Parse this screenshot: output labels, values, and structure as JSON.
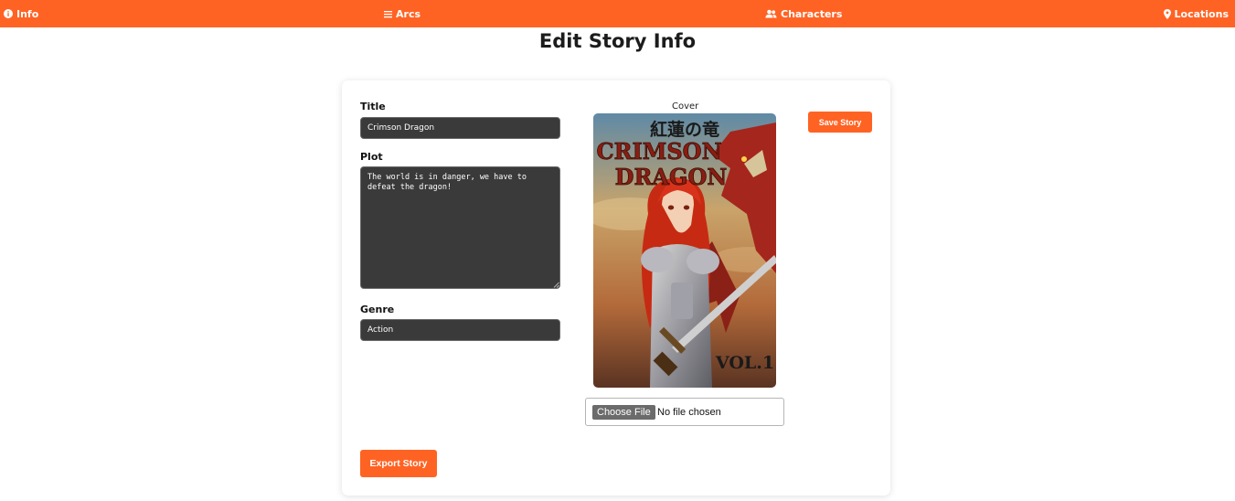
{
  "nav": {
    "info_label": "Info",
    "arcs_label": "Arcs",
    "characters_label": "Characters",
    "locations_label": "Locations"
  },
  "page": {
    "title": "Edit Story Info"
  },
  "form": {
    "title_label": "Title",
    "title_value": "Crimson Dragon",
    "plot_label": "Plot",
    "plot_value": "The world is in danger, we have to defeat the dragon!",
    "genre_label": "Genre",
    "genre_value": "Action"
  },
  "cover": {
    "label": "Cover",
    "image_title_jp": "紅蓮の竜",
    "image_title_line1": "CRIMSON",
    "image_title_line2": "DRAGON",
    "image_volume": "VOL.1",
    "file_button_label": "Choose File",
    "file_status": "No file chosen"
  },
  "actions": {
    "save_label": "Save Story",
    "export_label": "Export Story"
  },
  "colors": {
    "accent": "#ff6324",
    "input_bg": "#3a3a3a"
  },
  "icons": {
    "info": "info-circle-icon",
    "arcs": "bars-icon",
    "characters": "users-icon",
    "locations": "map-pin-icon"
  }
}
